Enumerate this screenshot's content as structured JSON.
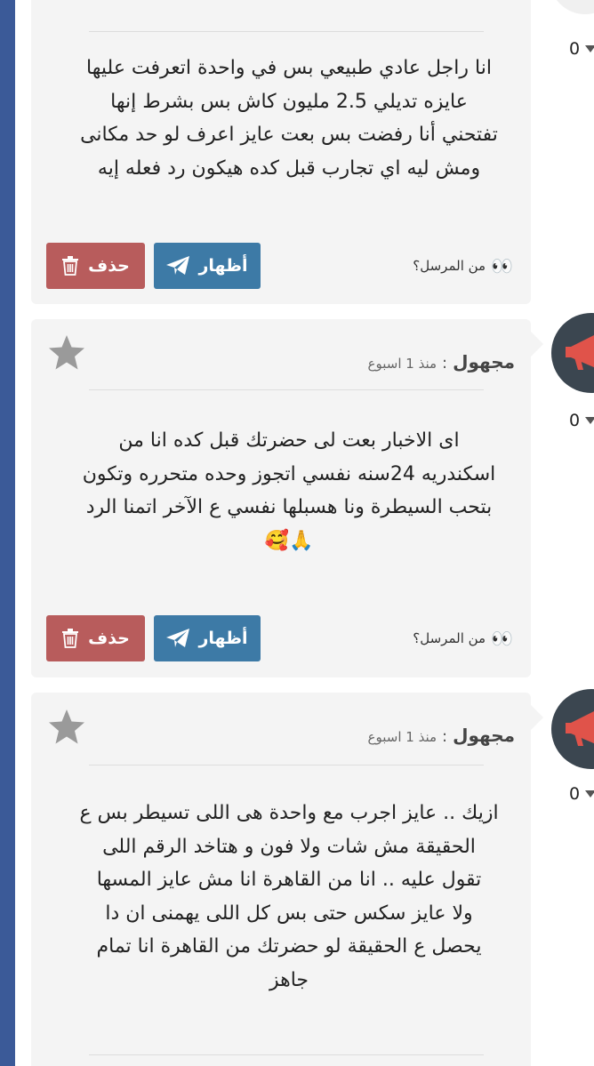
{
  "colors": {
    "sidebar": "#3b5a98",
    "card_bg": "#f4f4f4",
    "show_button": "#3d7aa6",
    "delete_button": "#b85c5c",
    "avatar_bg": "#3b4650",
    "avatar_accent": "#e0534a"
  },
  "messages": [
    {
      "lines": [
        "انا راجل عادي طبيعي بس في واحدة اتعرفت عليها",
        "عايزه تديلي 2.5 مليون كاش بس بشرط إنها",
        "تفتحني أنا رفضت بس بعت عايز اعرف لو حد مكانى",
        "ومش ليه اي تجارب قبل كده هيكون رد فعله إيه"
      ],
      "show_label": "أظهار",
      "delete_label": "حذف",
      "sender_prompt": "من المرسل؟",
      "sender_emoji": "👀",
      "side_count": "0"
    },
    {
      "author": "مجهول",
      "colon": ":",
      "time": "منذ 1 اسبوع",
      "lines": [
        "اى الاخبار بعت لى حضرتك قبل كده انا من",
        "اسكندريه 24سنه نفسي اتجوز وحده متحرره وتكون",
        "بتحب السيطرة ونا هسبلها نفسي ع الآخر اتمنا الرد",
        "🙏🥰"
      ],
      "show_label": "أظهار",
      "delete_label": "حذف",
      "sender_prompt": "من المرسل؟",
      "sender_emoji": "👀",
      "side_count": "0"
    },
    {
      "author": "مجهول",
      "colon": ":",
      "time": "منذ 1 اسبوع",
      "lines": [
        "ازيك .. عايز اجرب مع واحدة هى اللى تسيطر بس ع",
        "الحقيقة مش شات ولا فون و هتاخد الرقم اللى",
        "تقول عليه .. انا من القاهرة انا مش عايز المسها",
        "ولا عايز سكس حتى بس كل اللى يهمنى ان دا",
        "يحصل ع الحقيقة لو حضرتك من القاهرة انا تمام",
        "جاهز"
      ],
      "side_count": "0"
    }
  ]
}
